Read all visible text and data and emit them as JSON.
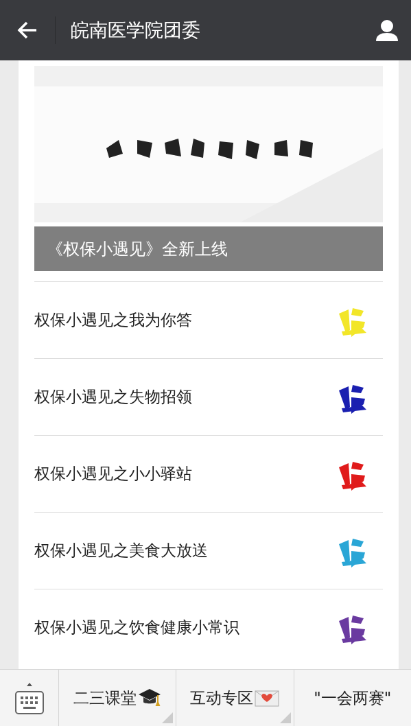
{
  "header": {
    "title": "皖南医学院团委"
  },
  "feature": {
    "title": "《权保小遇见》全新上线"
  },
  "articles": [
    {
      "title": "权保小遇见之我为你答",
      "color": "#f2e629"
    },
    {
      "title": "权保小遇见之失物招领",
      "color": "#1a1fb0"
    },
    {
      "title": "权保小遇见之小小驿站",
      "color": "#e01b1b"
    },
    {
      "title": "权保小遇见之美食大放送",
      "color": "#2aa6d6"
    },
    {
      "title": "权保小遇见之饮食健康小常识",
      "color": "#6a3aa0"
    }
  ],
  "menu": [
    {
      "label": "二三课堂",
      "kind": "cap"
    },
    {
      "label": "互动专区",
      "kind": "letter"
    },
    {
      "label": "\"一会两赛\"",
      "kind": "plain"
    }
  ]
}
